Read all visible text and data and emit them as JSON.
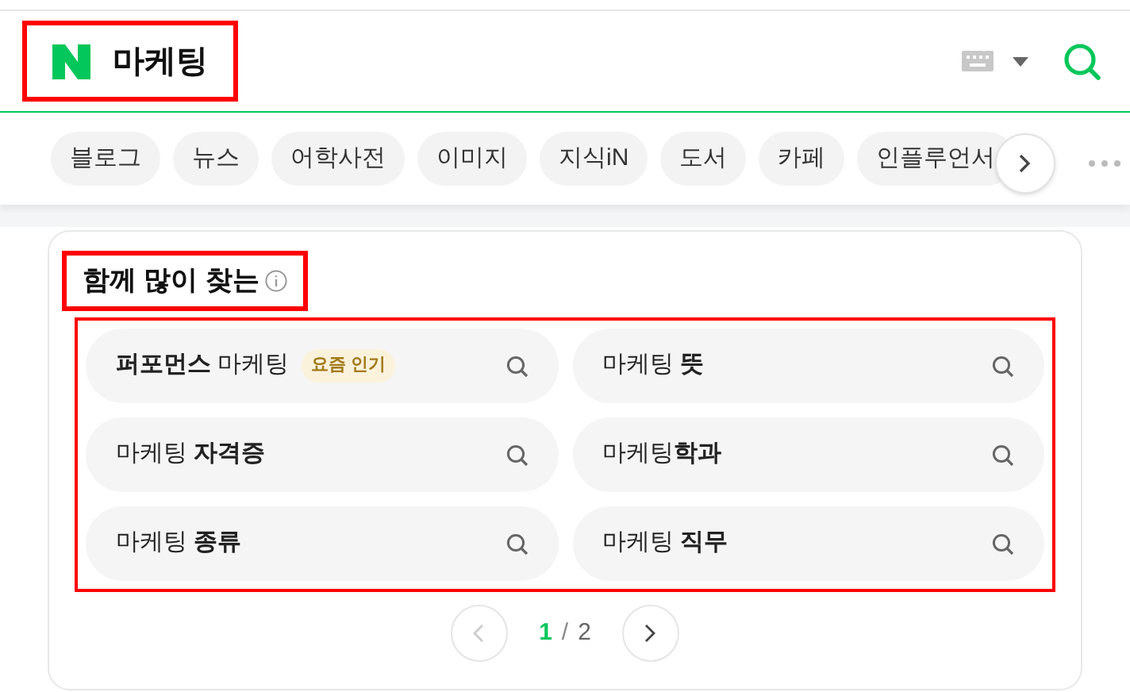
{
  "header": {
    "query": "마케팅",
    "highlighted": true
  },
  "tabs": [
    {
      "label": "블로그"
    },
    {
      "label": "뉴스"
    },
    {
      "label": "어학사전"
    },
    {
      "label": "이미지"
    },
    {
      "label": "지식iN"
    },
    {
      "label": "도서"
    },
    {
      "label": "카페"
    },
    {
      "label": "인플루언서"
    }
  ],
  "section": {
    "title": "함께 많이 찾는",
    "title_highlighted": true,
    "grid_highlighted": true,
    "items": [
      {
        "text": "**퍼포먼스** 마케팅",
        "badge": "요즘 인기"
      },
      {
        "text": "마케팅 **뜻**"
      },
      {
        "text": "마케팅 **자격증**"
      },
      {
        "text": "마케팅**학과**"
      },
      {
        "text": "마케팅 **종류**"
      },
      {
        "text": "마케팅 **직무**"
      }
    ],
    "pagination": {
      "current": "1",
      "separator": "/",
      "total": "2"
    }
  }
}
